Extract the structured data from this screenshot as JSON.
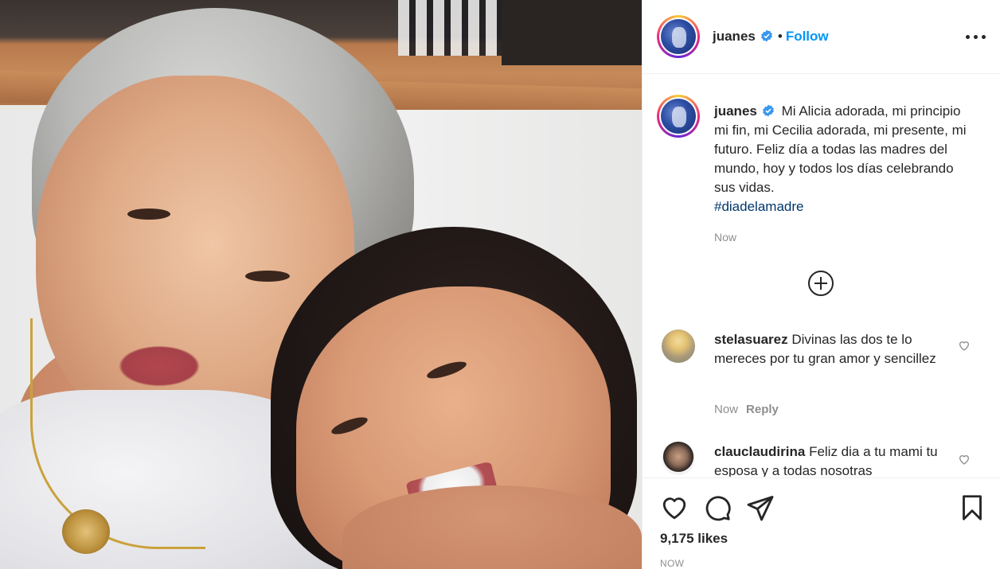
{
  "post": {
    "username": "juanes",
    "verified": true,
    "follow_label": "Follow",
    "caption_text": "Mi Alicia adorada, mi principio mi fin, mi Cecilia adorada, mi presente, mi futuro. Feliz día a todas las madres del mundo, hoy y todos los días celebrando sus vidas.",
    "hashtag": "#diadelamadre",
    "caption_time": "Now",
    "likes_text": "9,175 likes",
    "post_time": "NOW"
  },
  "comments": [
    {
      "username": "stelasuarez",
      "text": "Divinas las dos te lo mereces por tu gran amor y sencillez",
      "time": "Now",
      "reply_label": "Reply"
    },
    {
      "username": "clauclaudirina",
      "text": "Feliz dia a tu mami tu esposa y a todas nosotras"
    }
  ],
  "icons": {
    "more": "more-options-icon",
    "load_more": "plus-circle-icon",
    "like": "heart-icon",
    "comment": "comment-icon",
    "share": "paper-plane-icon",
    "save": "bookmark-icon"
  },
  "colors": {
    "link_blue": "#0095f6",
    "hashtag_blue": "#00376b",
    "text": "#262626",
    "muted": "#8e8e8e"
  }
}
